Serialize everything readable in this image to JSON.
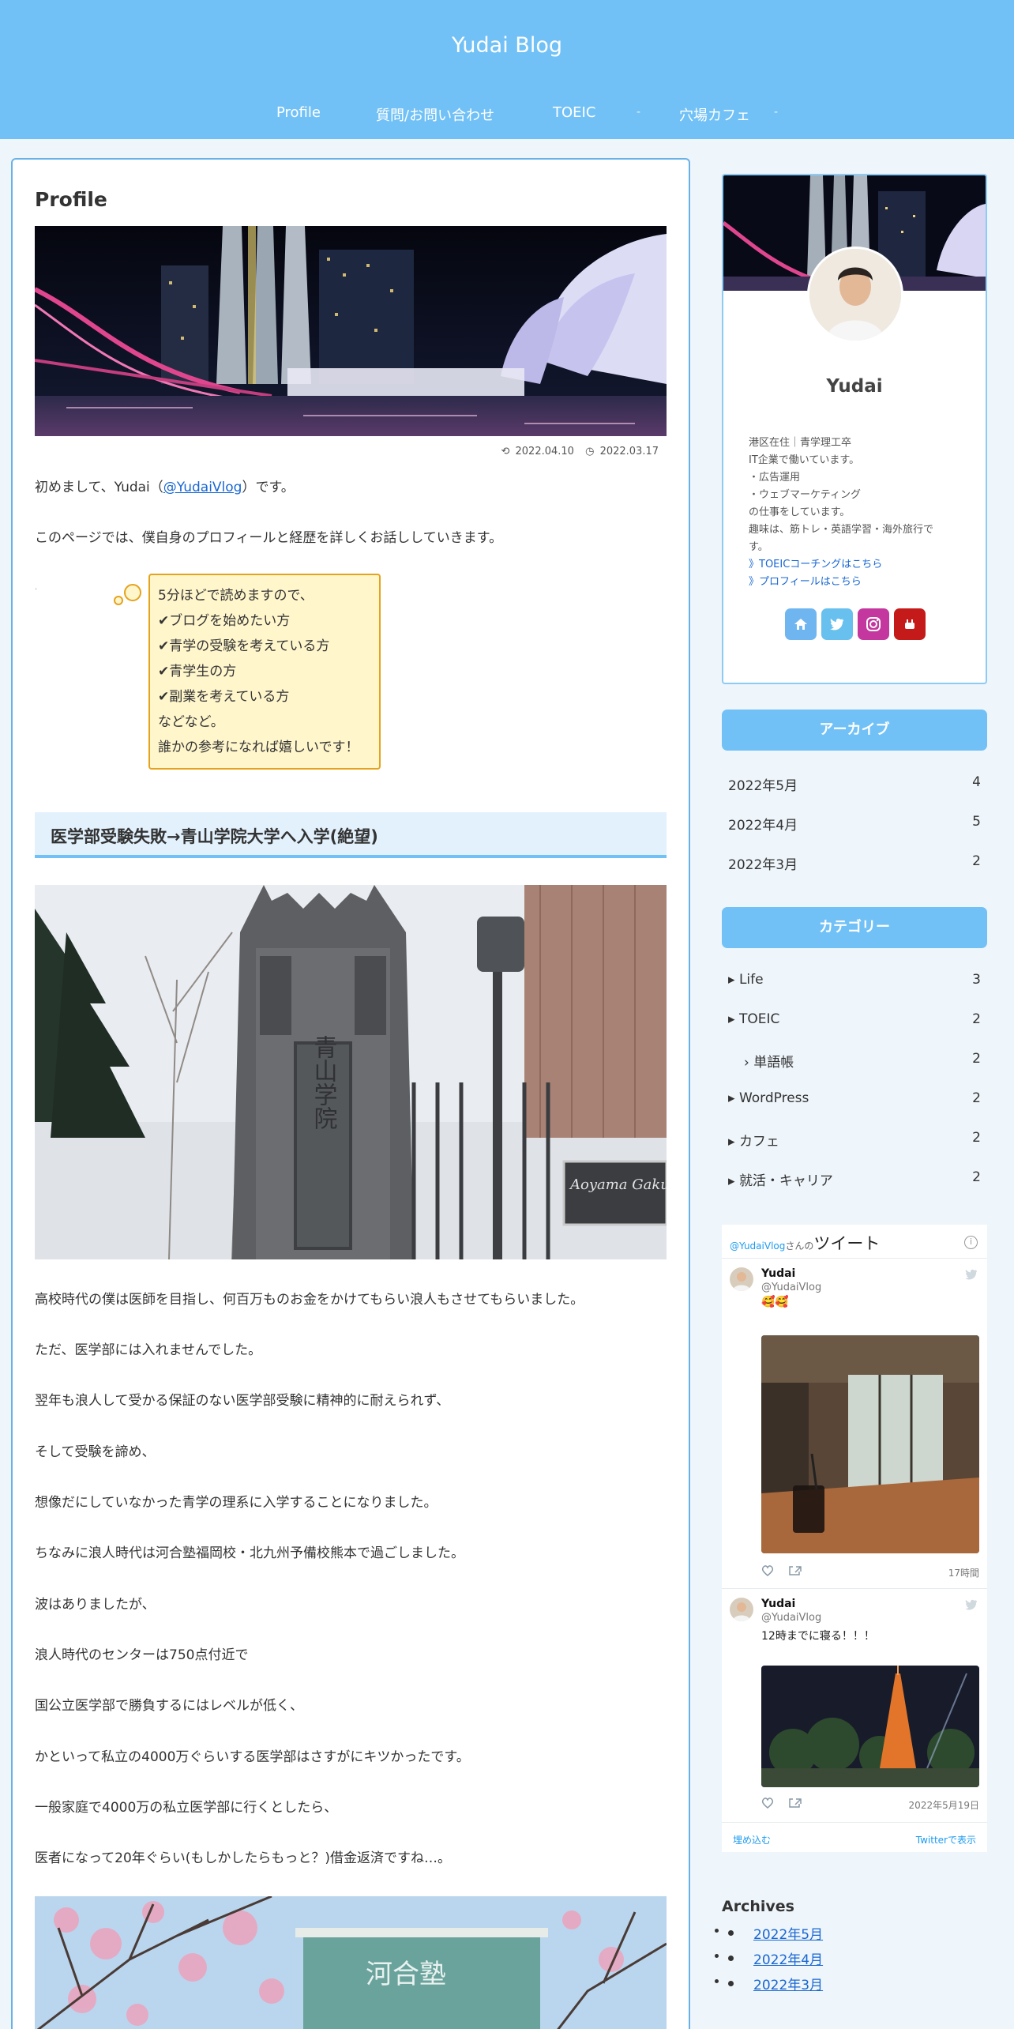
{
  "site": {
    "title": "Yudai Blog"
  },
  "nav": {
    "items": [
      {
        "label": "Profile"
      },
      {
        "label": "質問/お問い合わせ"
      },
      {
        "label": "TOEIC",
        "caret": "-"
      },
      {
        "label": "穴場カフェ",
        "caret": "-"
      }
    ]
  },
  "article": {
    "title": "Profile",
    "updated_date": "2022.04.10",
    "published_date": "2022.03.17",
    "intro": {
      "before": "初めまして、Yudai（",
      "link": "@YudaiVlog",
      "after": "）です。"
    },
    "intro2": "このページでは、僕自身のプロフィールと経歴を詳しくお話ししていきます。",
    "dot": ".",
    "balloon_lines": [
      "5分ほどで読めますので、",
      "✔ブログを始めたい方",
      "✔青学の受験を考えている方",
      "✔青学生の方",
      "✔副業を考えている方",
      "などなど。",
      "誰かの参考になれば嬉しいです！"
    ],
    "heading": "医学部受験失敗→青山学院大学へ入学(絶望)",
    "paragraphs": [
      "高校時代の僕は医師を目指し、何百万ものお金をかけてもらい浪人もさせてもらいました。",
      "ただ、医学部には入れませんでした。",
      "翌年も浪人して受かる保証のない医学部受験に精神的に耐えられず、",
      "そして受験を諦め、",
      "想像だにしていなかった青学の理系に入学することになりました。",
      "ちなみに浪人時代は河合塾福岡校・北九州予備校熊本で過ごしました。",
      "波はありましたが、",
      "浪人時代のセンターは750点付近で",
      "国公立医学部で勝負するにはレベルが低く、",
      "かといって私立の4000万ぐらいする医学部はさすがにキツかったです。",
      "一般家庭で4000万の私立医学部に行くとしたら、",
      "医者になって20年ぐらい(もしかしたらもっと？)借金返済ですね…。"
    ],
    "sign_text": "Aoyama Gakuin Universi",
    "pillar_text": "青山学院",
    "cherry_sign_text": "河合塾"
  },
  "profile": {
    "name": "Yudai",
    "bio": [
      "港区在住｜青学理工卒",
      "IT企業で働いています。",
      "・広告運用",
      "・ウェブマーケティング",
      "の仕事をしています。",
      "趣味は、筋トレ・英語学習・海外旅行で",
      "す。"
    ],
    "links": [
      "》TOEICコーチングはこちら",
      "》プロフィールはこちら"
    ],
    "social_icons": [
      "home-icon",
      "twitter-icon",
      "instagram-icon",
      "youtube-icon"
    ],
    "colors": {
      "home": "#6fb6f0",
      "twitter": "#68c0ee",
      "instagram": "#c4379e",
      "youtube": "#c41a1a"
    }
  },
  "archive_widget": {
    "title": "アーカイブ",
    "items": [
      {
        "label": "2022年5月",
        "count": "4"
      },
      {
        "label": "2022年4月",
        "count": "5"
      },
      {
        "label": "2022年3月",
        "count": "2"
      }
    ]
  },
  "category_widget": {
    "title": "カテゴリー",
    "items": [
      {
        "label": "Life",
        "count": "3"
      },
      {
        "label": "TOEIC",
        "count": "2"
      },
      {
        "label": "単語帳",
        "count": "2"
      },
      {
        "label": "WordPress",
        "count": "2"
      },
      {
        "label": "カフェ",
        "count": "2"
      },
      {
        "label": "就活・キャリア",
        "count": "2"
      }
    ]
  },
  "twitter": {
    "handle": "@YudaiVlog",
    "san": "さんの",
    "tweet_word": "ツイート",
    "info": "i",
    "tweets": [
      {
        "name": "Yudai",
        "user": "@YudaiVlog",
        "text": "🥰🥰",
        "time": "17時間"
      },
      {
        "name": "Yudai",
        "user": "@YudaiVlog",
        "text": "12時までに寝る！！！",
        "time": "2022年5月19日"
      }
    ],
    "embed": "埋め込む",
    "view_on_twitter": "Twitterで表示"
  },
  "archives_widget": {
    "title": "Archives",
    "items": [
      "2022年5月",
      "2022年4月",
      "2022年3月"
    ]
  },
  "colors": {
    "header": "#72c1f6",
    "accent_border": "#6ab2e6",
    "balloon_bg": "#fff6cc",
    "balloon_border": "#e5a21d",
    "heading_bg": "#e3f1fd"
  }
}
